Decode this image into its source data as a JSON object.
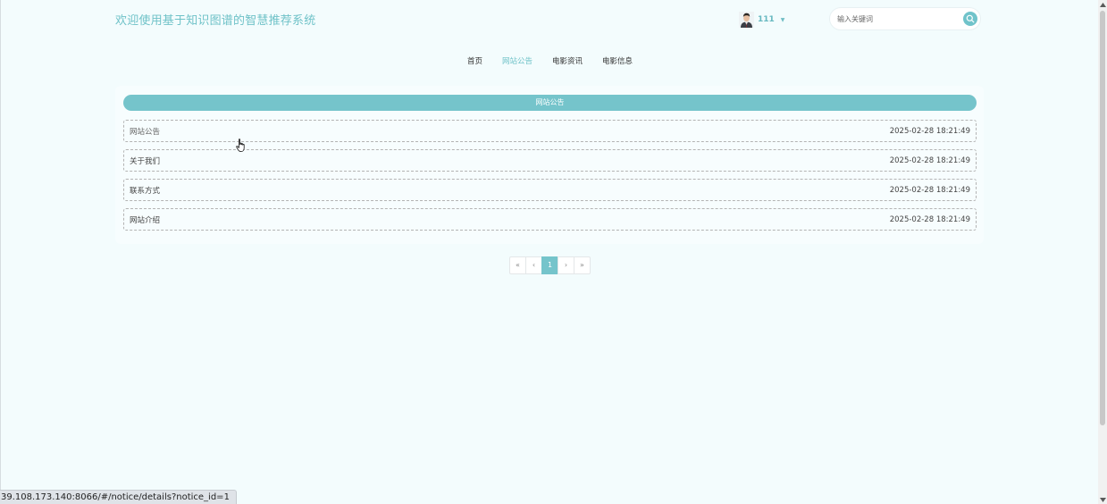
{
  "header": {
    "title": "欢迎使用基于知识图谱的智慧推荐系统",
    "user": {
      "name": "111",
      "caret": "▼"
    },
    "search": {
      "placeholder": "输入关键词"
    }
  },
  "nav": {
    "items": [
      {
        "label": "首页"
      },
      {
        "label": "网站公告"
      },
      {
        "label": "电影资讯"
      },
      {
        "label": "电影信息"
      }
    ],
    "active_index": 1
  },
  "notice_section": {
    "heading": "网站公告",
    "items": [
      {
        "title": "网站公告",
        "time": "2025-02-28 18:21:49"
      },
      {
        "title": "关于我们",
        "time": "2025-02-28 18:21:49"
      },
      {
        "title": "联系方式",
        "time": "2025-02-28 18:21:49"
      },
      {
        "title": "网站介绍",
        "time": "2025-02-28 18:21:49"
      }
    ]
  },
  "pagination": {
    "first": "«",
    "prev": "‹",
    "current": "1",
    "next": "›",
    "last": "»"
  },
  "status_bar": {
    "url": "39.108.173.140:8066/#/notice/details?notice_id=1"
  },
  "colors": {
    "accent": "#75c4cb",
    "background": "#f3fcfd",
    "title_text": "#6fc2c8"
  }
}
